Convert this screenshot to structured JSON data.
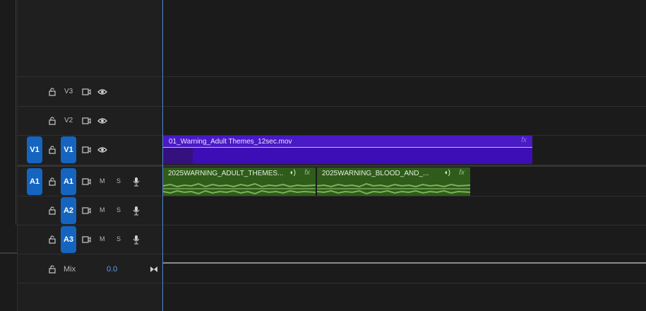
{
  "tracks": {
    "v3": {
      "label": "V3"
    },
    "v2": {
      "label": "V2"
    },
    "v1": {
      "label": "V1",
      "source": "V1"
    },
    "a1": {
      "label": "A1",
      "source": "A1",
      "mute": "M",
      "solo": "S"
    },
    "a2": {
      "label": "A2",
      "mute": "M",
      "solo": "S"
    },
    "a3": {
      "label": "A3",
      "mute": "M",
      "solo": "S"
    }
  },
  "mix": {
    "label": "Mix",
    "value": "0.0"
  },
  "clips": {
    "video1": {
      "name": "01_Warning_Adult Themes_12sec.mov",
      "fx": "fx"
    },
    "audio1": {
      "name": "2025WARNING_ADULT_THEMES...",
      "fx": "fx"
    },
    "audio2": {
      "name": "2025WARNING_BLOOD_AND_...",
      "fx": "fx"
    }
  },
  "colors": {
    "accent": "#1565c0",
    "video_clip": "#3d0eb5",
    "audio_clip": "#2f5c1a",
    "playhead": "#4f86d0"
  }
}
